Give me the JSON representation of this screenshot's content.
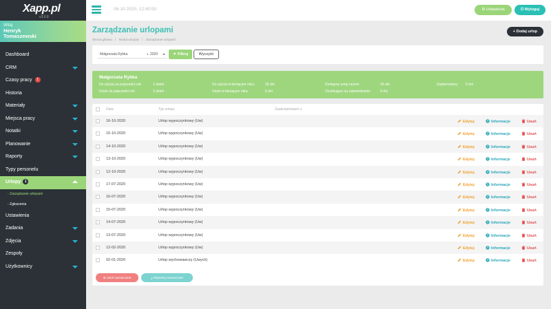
{
  "app": {
    "logo": "Xapp.pl",
    "version": "v3.0.8"
  },
  "user": {
    "hello": "Witaj",
    "name_line1": "Henryk",
    "name_line2": "Tomaszewski"
  },
  "topbar": {
    "datetime": "06-10-2020, 12:40:50",
    "settings_label": "Ustawienia",
    "logout_label": "Wyloguj"
  },
  "sidebar": {
    "items": [
      {
        "label": "Dashboard"
      },
      {
        "label": "CRM"
      },
      {
        "label": "Czasy pracy",
        "badge": "1"
      },
      {
        "label": "Historia"
      },
      {
        "label": "Materiały"
      },
      {
        "label": "Miejsca pracy"
      },
      {
        "label": "Notatki"
      },
      {
        "label": "Planowanie"
      },
      {
        "label": "Raporty"
      },
      {
        "label": "Typy personelu"
      },
      {
        "label": "Urlopy",
        "badge": "1"
      },
      {
        "label": "Ustawienia"
      },
      {
        "label": "Zadania"
      },
      {
        "label": "Zdjęcia"
      },
      {
        "label": "Zespoły"
      },
      {
        "label": "Użytkownicy"
      }
    ],
    "sub_items": [
      {
        "label": "- Zarządzanie urlopami"
      },
      {
        "label": "- Zgłoszenia"
      }
    ]
  },
  "page": {
    "title": "Zarządzanie urlopami",
    "breadcrumb": [
      "Strona główna",
      "/",
      "Moduł urlopów",
      "/",
      "Zarządzanie urlopami"
    ],
    "add_label": "Dodaj urlop"
  },
  "filter": {
    "user_value": "Małgorzata Rybka",
    "year_value": "2020",
    "filter_label": "Filtruj",
    "clear_label": "Wyczyść"
  },
  "summary": {
    "name": "Małgorzata Rybka",
    "cells": [
      {
        "label": "Do użycia za poprzedni rok:",
        "value": "1 dzień"
      },
      {
        "label": "Użyto za poprzedni rok:",
        "value": "1 dzień"
      },
      {
        "label": "Do użycia w bieżącym roku:",
        "value": "26 dni"
      },
      {
        "label": "Użyto w bieżącym roku:",
        "value": "5 dni"
      },
      {
        "label": "Dostępny urlop razem:",
        "value": "16 dni"
      },
      {
        "label": "Oczekujące na zatwierdzenie:",
        "value": "0 dni"
      },
      {
        "label": "Zaplanowany:",
        "value": "5 dni"
      }
    ]
  },
  "table": {
    "headers": {
      "date": "Data",
      "type": "Typ urlopu",
      "accepted": "Zaakceptowano z"
    },
    "actions": {
      "edit": "Edytuj",
      "info": "Informacje",
      "delete": "Usuń"
    },
    "rows": [
      {
        "date": "16-10-2020",
        "type": "Urlop wypoczynkowy (Uw)"
      },
      {
        "date": "15-10-2020",
        "type": "Urlop wypoczynkowy (Uw)"
      },
      {
        "date": "14-10-2020",
        "type": "Urlop wypoczynkowy (Uw)"
      },
      {
        "date": "13-10-2020",
        "type": "Urlop wypoczynkowy (Uw)"
      },
      {
        "date": "12-10-2020",
        "type": "Urlop wypoczynkowy (Uw)"
      },
      {
        "date": "17-07-2020",
        "type": "Urlop wypoczynkowy (Uw)"
      },
      {
        "date": "16-07-2020",
        "type": "Urlop wypoczynkowy (Uw)"
      },
      {
        "date": "15-07-2020",
        "type": "Urlop wypoczynkowy (Uw)"
      },
      {
        "date": "14-07-2020",
        "type": "Urlop wypoczynkowy (Uw)"
      },
      {
        "date": "13-07-2020",
        "type": "Urlop wypoczynkowy (Uw)"
      },
      {
        "date": "12-02-2020",
        "type": "Urlop wypoczynkowy (Uw)"
      },
      {
        "date": "02-01-2020",
        "type": "Urlop wychowawczy (Uwych)"
      }
    ],
    "delete_selected_label": "Usuń zaznaczone",
    "export_selected_label": "eksportuj zaznaczone"
  },
  "colors": {
    "sidebar": "#2b3136",
    "accent_green": "#9bd57a",
    "accent_teal": "#3cbfb5",
    "edit": "#f0a030",
    "info": "#2aa8b8",
    "delete": "#e24a4a"
  }
}
